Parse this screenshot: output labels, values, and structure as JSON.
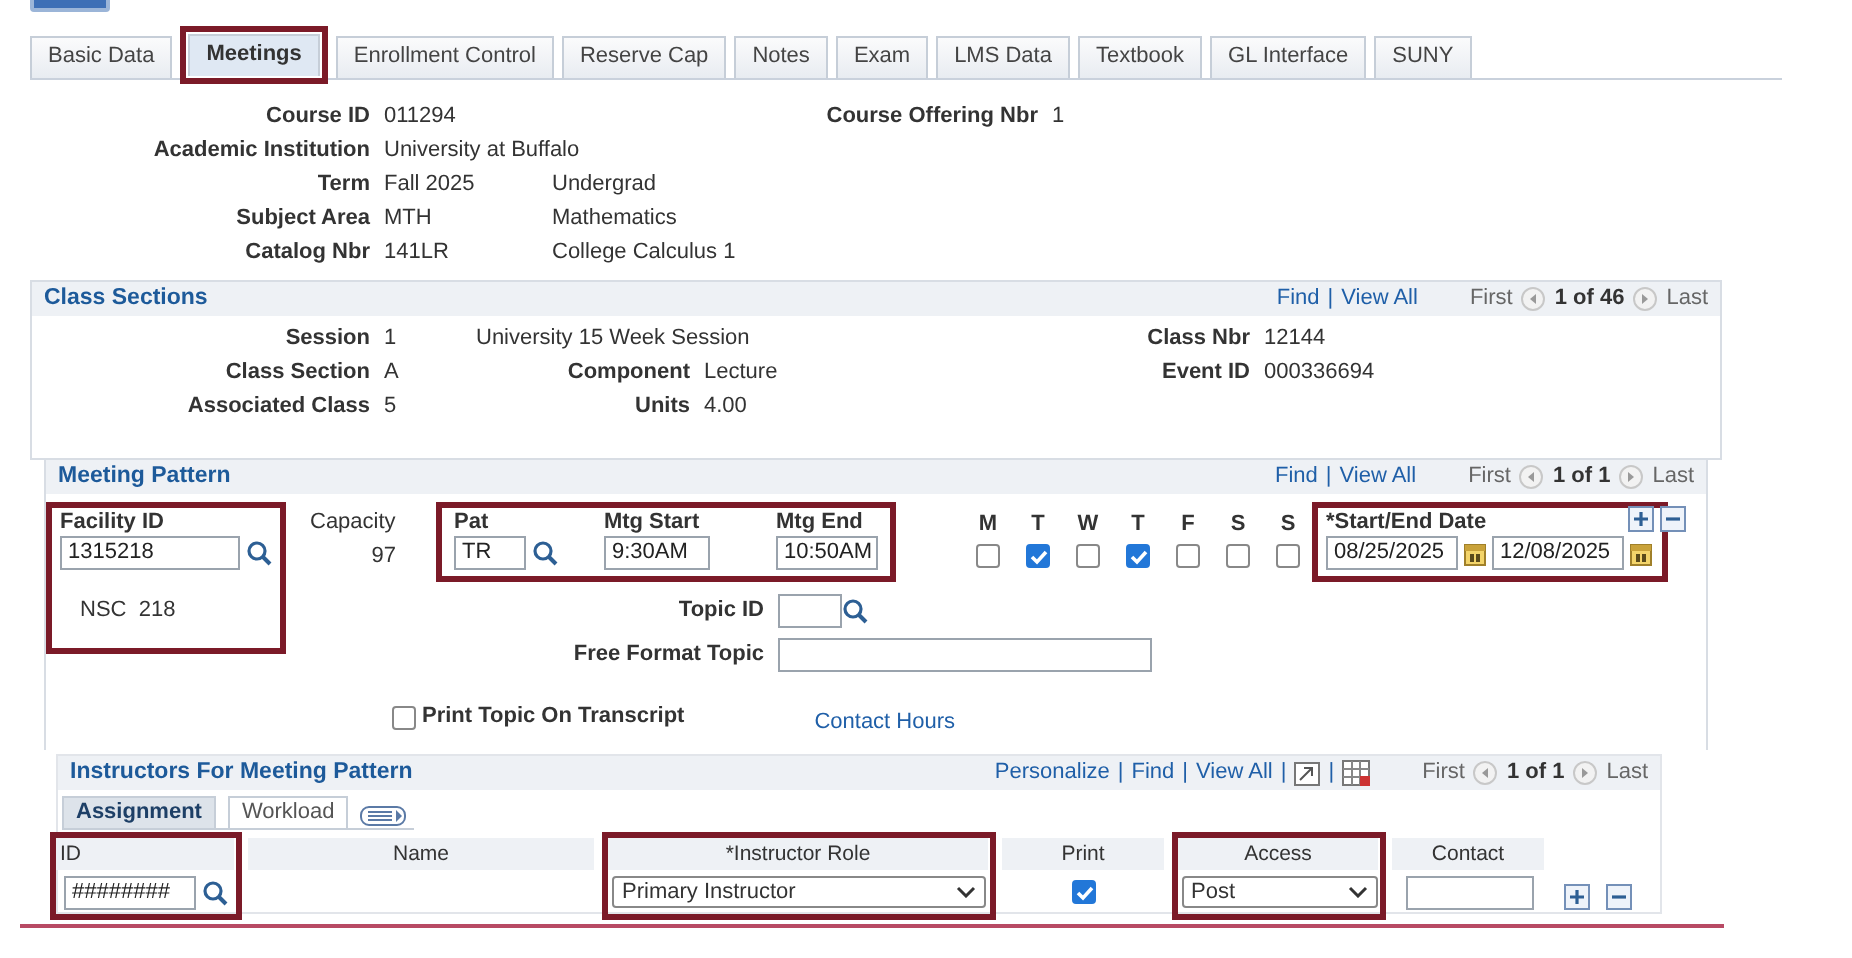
{
  "tabs": [
    {
      "label": "Basic Data",
      "selected": false,
      "highlighted": false
    },
    {
      "label": "Meetings",
      "selected": true,
      "highlighted": true
    },
    {
      "label": "Enrollment Control",
      "selected": false,
      "highlighted": false
    },
    {
      "label": "Reserve Cap",
      "selected": false,
      "highlighted": false
    },
    {
      "label": "Notes",
      "selected": false,
      "highlighted": false
    },
    {
      "label": "Exam",
      "selected": false,
      "highlighted": false
    },
    {
      "label": "LMS Data",
      "selected": false,
      "highlighted": false
    },
    {
      "label": "Textbook",
      "selected": false,
      "highlighted": false
    },
    {
      "label": "GL Interface",
      "selected": false,
      "highlighted": false
    },
    {
      "label": "SUNY",
      "selected": false,
      "highlighted": false
    }
  ],
  "course": {
    "rows": [
      {
        "label": "Course ID",
        "value": "011294"
      },
      {
        "label": "Academic Institution",
        "value": "University at Buffalo"
      },
      {
        "label": "Term",
        "value": "Fall 2025",
        "description": "Undergrad"
      },
      {
        "label": "Subject Area",
        "value": "MTH",
        "description": "Mathematics"
      },
      {
        "label": "Catalog Nbr",
        "value": "141LR",
        "description": "College Calculus 1"
      }
    ],
    "offering": {
      "label": "Course Offering Nbr",
      "value": "1"
    }
  },
  "class_sections": {
    "title": "Class Sections",
    "nav": {
      "links": [
        "Find",
        "View All"
      ],
      "separator": "|",
      "first": "First",
      "count": "1 of 46",
      "last": "Last"
    },
    "session": {
      "label": "Session",
      "value": "1",
      "description": "University 15 Week Session"
    },
    "class_nbr": {
      "label": "Class Nbr",
      "value": "12144"
    },
    "class_section": {
      "label": "Class Section",
      "value": "A"
    },
    "component": {
      "label": "Component",
      "value": "Lecture"
    },
    "event_id": {
      "label": "Event ID",
      "value": "000336694"
    },
    "associated_class": {
      "label": "Associated Class",
      "value": "5"
    },
    "units": {
      "label": "Units",
      "value": "4.00"
    }
  },
  "meeting_pattern": {
    "title": "Meeting Pattern",
    "nav": {
      "links": [
        "Find",
        "View All"
      ],
      "separator": "|",
      "first": "First",
      "count": "1 of 1",
      "last": "Last"
    },
    "facility": {
      "label": "Facility ID",
      "value": "1315218",
      "description": "NSC  218",
      "highlighted": true
    },
    "capacity": {
      "label": "Capacity",
      "value": "97"
    },
    "pattern": {
      "highlighted": true,
      "pat": {
        "label": "Pat",
        "value": "TR"
      },
      "start": {
        "label": "Mtg Start",
        "value": "9:30AM"
      },
      "end": {
        "label": "Mtg End",
        "value": "10:50AM"
      }
    },
    "days": [
      {
        "label": "M",
        "checked": false
      },
      {
        "label": "T",
        "checked": true
      },
      {
        "label": "W",
        "checked": false
      },
      {
        "label": "T",
        "checked": true
      },
      {
        "label": "F",
        "checked": false
      },
      {
        "label": "S",
        "checked": false
      },
      {
        "label": "S",
        "checked": false
      }
    ],
    "dates": {
      "highlighted": true,
      "label": "*Start/End Date",
      "start": "08/25/2025",
      "end": "12/08/2025"
    },
    "topic_id": {
      "label": "Topic ID"
    },
    "free_format_topic": {
      "label": "Free Format Topic"
    },
    "print_topic": {
      "label": "Print Topic On Transcript",
      "checked": false
    },
    "contact_hours": "Contact Hours"
  },
  "instructors": {
    "title": "Instructors For Meeting Pattern",
    "nav": {
      "links": [
        "Personalize",
        "Find",
        "View All"
      ],
      "separator": "|",
      "first": "First",
      "count": "1 of 1",
      "last": "Last"
    },
    "tabs": [
      {
        "label": "Assignment",
        "selected": true
      },
      {
        "label": "Workload",
        "selected": false
      }
    ],
    "columns": [
      {
        "label": "ID",
        "highlighted": true
      },
      {
        "label": "Name",
        "highlighted": false
      },
      {
        "label": "*Instructor Role",
        "highlighted": true
      },
      {
        "label": "Print",
        "highlighted": false
      },
      {
        "label": "Access",
        "highlighted": true
      },
      {
        "label": "Contact",
        "highlighted": false
      }
    ],
    "row": {
      "id": "########",
      "role": "Primary Instructor",
      "print": true,
      "access": "Post"
    }
  }
}
